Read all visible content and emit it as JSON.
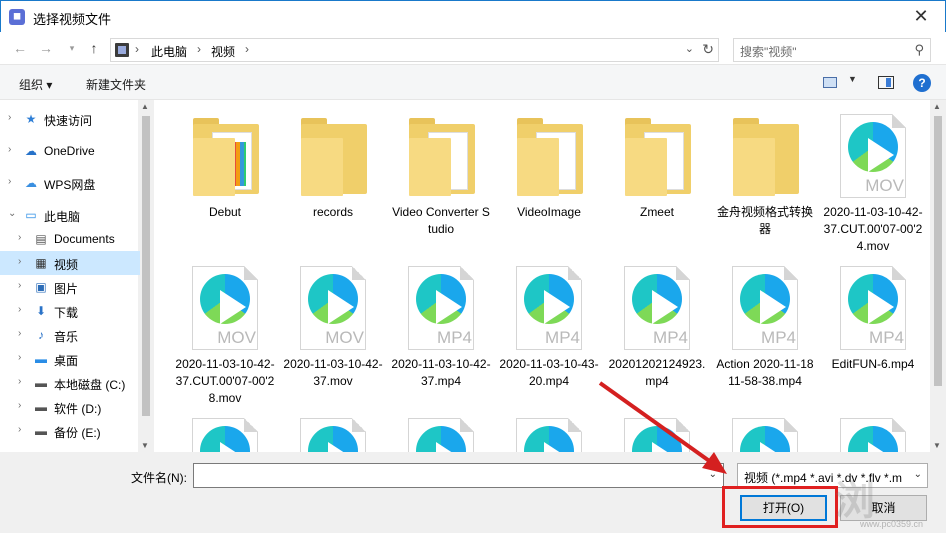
{
  "window": {
    "title": "选择视频文件",
    "close_glyph": "✕"
  },
  "nav": {
    "breadcrumbs": [
      "此电脑",
      "视频"
    ],
    "search_placeholder": "搜索\"视频\""
  },
  "toolbar": {
    "organize": "组织 ▾",
    "new_folder": "新建文件夹",
    "help": "?"
  },
  "sidebar": {
    "items": [
      {
        "label": "快速访问",
        "icon": "star-icon",
        "glyph": "★",
        "color": "#2f7fd6",
        "indent": 0,
        "selected": false
      },
      {
        "label": "OneDrive",
        "icon": "cloud-icon",
        "glyph": "☁",
        "color": "#2672c9",
        "indent": 0,
        "selected": false
      },
      {
        "label": "WPS网盘",
        "icon": "wps-cloud-icon",
        "glyph": "☁",
        "color": "#3a8fe0",
        "indent": 0,
        "selected": false
      },
      {
        "label": "此电脑",
        "icon": "computer-icon",
        "glyph": "▭",
        "color": "#2a8de6",
        "indent": 0,
        "selected": false
      },
      {
        "label": "Documents",
        "icon": "document-icon",
        "glyph": "▤",
        "color": "#555555",
        "indent": 1,
        "selected": false
      },
      {
        "label": "视频",
        "icon": "video-folder-icon",
        "glyph": "▦",
        "color": "#333333",
        "indent": 1,
        "selected": true
      },
      {
        "label": "图片",
        "icon": "pictures-icon",
        "glyph": "▣",
        "color": "#2c6db8",
        "indent": 1,
        "selected": false
      },
      {
        "label": "下载",
        "icon": "download-icon",
        "glyph": "⬇",
        "color": "#2a73c8",
        "indent": 1,
        "selected": false
      },
      {
        "label": "音乐",
        "icon": "music-icon",
        "glyph": "♪",
        "color": "#2a73c8",
        "indent": 1,
        "selected": false
      },
      {
        "label": "桌面",
        "icon": "desktop-icon",
        "glyph": "▬",
        "color": "#2a8de6",
        "indent": 1,
        "selected": false
      },
      {
        "label": "本地磁盘 (C:)",
        "icon": "drive-icon",
        "glyph": "▬",
        "color": "#555555",
        "indent": 1,
        "selected": false
      },
      {
        "label": "软件 (D:)",
        "icon": "drive-icon",
        "glyph": "▬",
        "color": "#555555",
        "indent": 1,
        "selected": false
      },
      {
        "label": "备份 (E:)",
        "icon": "drive-icon",
        "glyph": "▬",
        "color": "#555555",
        "indent": 1,
        "selected": false
      }
    ]
  },
  "files": [
    {
      "name": "Debut",
      "kind": "folder-colorful"
    },
    {
      "name": "records",
      "kind": "folder-empty"
    },
    {
      "name": "Video Converter Studio",
      "kind": "folder"
    },
    {
      "name": "VideoImage",
      "kind": "folder"
    },
    {
      "name": "Zmeet",
      "kind": "folder"
    },
    {
      "name": "金舟视频格式转换器",
      "kind": "folder-empty"
    },
    {
      "name": "2020-11-03-10-42-37.CUT.00'07-00'24.mov",
      "kind": "video",
      "ext": "MOV"
    },
    {
      "name": "2020-11-03-10-42-37.CUT.00'07-00'28.mov",
      "kind": "video",
      "ext": "MOV"
    },
    {
      "name": "2020-11-03-10-42-37.mov",
      "kind": "video",
      "ext": "MOV"
    },
    {
      "name": "2020-11-03-10-42-37.mp4",
      "kind": "video",
      "ext": "MP4"
    },
    {
      "name": "2020-11-03-10-43-20.mp4",
      "kind": "video",
      "ext": "MP4"
    },
    {
      "name": "20201202124923.mp4",
      "kind": "video",
      "ext": "MP4"
    },
    {
      "name": "Action 2020-11-18 11-58-38.mp4",
      "kind": "video",
      "ext": "MP4"
    },
    {
      "name": "EditFUN-6.mp4",
      "kind": "video",
      "ext": "MP4"
    },
    {
      "name": "",
      "kind": "video",
      "ext": ""
    },
    {
      "name": "",
      "kind": "video",
      "ext": ""
    },
    {
      "name": "",
      "kind": "video",
      "ext": ""
    },
    {
      "name": "",
      "kind": "video",
      "ext": ""
    },
    {
      "name": "",
      "kind": "video",
      "ext": ""
    },
    {
      "name": "",
      "kind": "video",
      "ext": ""
    },
    {
      "name": "",
      "kind": "video",
      "ext": ""
    }
  ],
  "footer": {
    "filename_label": "文件名(N):",
    "filename_value": "",
    "filetype": "视频 (*.mp4 *.avi *.dv *.flv *.m",
    "open_label": "打开(O)",
    "cancel_label": "取消"
  },
  "watermark": {
    "text": "浏",
    "url": "www.pc0359.cn"
  },
  "colors": {
    "accent": "#0078d7",
    "highlight": "#e02020",
    "selected_bg": "#cce8ff"
  }
}
